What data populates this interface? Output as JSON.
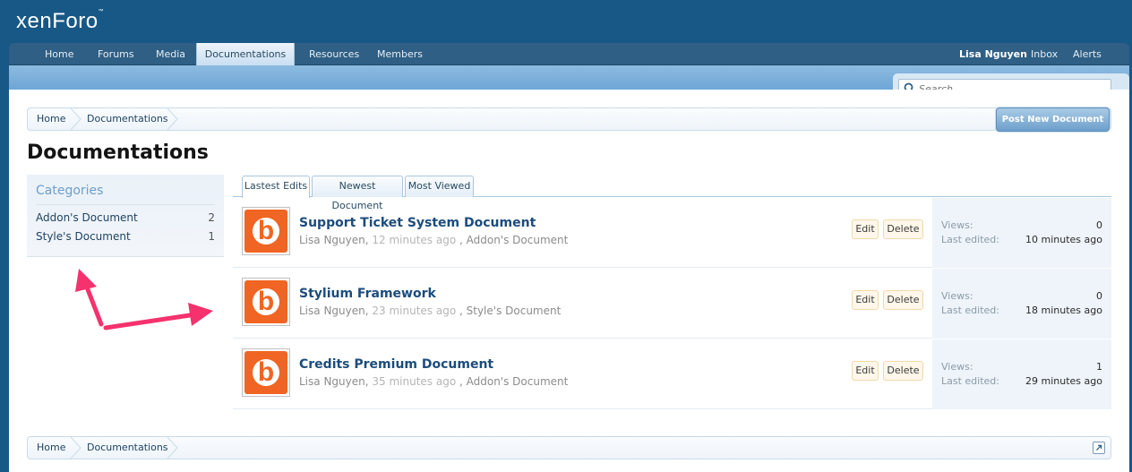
{
  "logo": {
    "text": "xenForo",
    "mark": "™"
  },
  "nav": {
    "tabs": [
      "Home",
      "Forums",
      "Media",
      "Documentations",
      "Resources",
      "Members"
    ],
    "active_tab": "Documentations",
    "user": "Lisa Nguyen",
    "inbox": "Inbox",
    "alerts": "Alerts"
  },
  "search": {
    "placeholder": "Search..."
  },
  "breadcrumb": {
    "items": [
      "Home",
      "Documentations"
    ]
  },
  "post_button": "Post New Document",
  "page_title": "Documentations",
  "sidebar": {
    "title": "Categories",
    "items": [
      {
        "label": "Addon's Document",
        "count": "2"
      },
      {
        "label": "Style's Document",
        "count": "1"
      }
    ]
  },
  "tabs": [
    "Lastest Edits",
    "Newest Document",
    "Most Viewed"
  ],
  "documents": [
    {
      "title": "Support Ticket System Document",
      "author": "Lisa Nguyen,",
      "time": "12 minutes ago",
      "category": ", Addon's Document",
      "edit": "Edit",
      "delete": "Delete",
      "views_label": "Views:",
      "views": "0",
      "edited_label": "Last edited:",
      "edited": "10 minutes ago"
    },
    {
      "title": "Stylium Framework",
      "author": "Lisa Nguyen,",
      "time": "23 minutes ago",
      "category": ", Style's Document",
      "edit": "Edit",
      "delete": "Delete",
      "views_label": "Views:",
      "views": "0",
      "edited_label": "Last edited:",
      "edited": "18 minutes ago"
    },
    {
      "title": "Credits Premium Document",
      "author": "Lisa Nguyen,",
      "time": "35 minutes ago",
      "category": ", Addon's Document",
      "edit": "Edit",
      "delete": "Delete",
      "views_label": "Views:",
      "views": "1",
      "edited_label": "Last edited:",
      "edited": "29 minutes ago"
    }
  ],
  "thumb_glyph": "b",
  "colors": {
    "header": "#185886",
    "accent_orange": "#f06523",
    "arrow": "#f5326e",
    "link": "#1c4c7c"
  }
}
